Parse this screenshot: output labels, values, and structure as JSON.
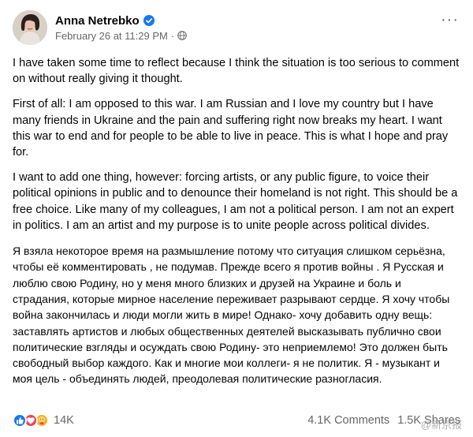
{
  "post": {
    "author": "Anna Netrebko",
    "timestamp": "February 26 at 11:29 PM",
    "separator": "·",
    "more_label": "···",
    "paragraphs": [
      "I have taken some time to reflect because I think the situation is too serious to comment on without really giving it thought.",
      "First of all: I am opposed to this war. I am Russian and I love my country but I have many friends in Ukraine and the pain and suffering right now breaks my heart. I want this war to end and for people to be able to live in peace. This is what I hope and pray for.",
      "I want to add one thing, however: forcing artists, or any public figure, to voice their political opinions in public and to denounce their homeland is not right. This should be a free choice. Like many of my colleagues, I am not a political person. I am not an expert in politics. I am an artist and my purpose is to unite people across political divides."
    ],
    "russian_paragraph": "Я взяла некоторое время на размышление потому что ситуация слишком серьёзна, чтобы её комментировать , не подумав. Прежде всего я против войны . Я Русская и люблю свою Родину, но у меня много близких и друзей на Украине и боль и страдания, которые мирное население переживает разрывают сердце. Я хочу чтобы война закончилась и люди могли жить в мире!   Однако- хочу добавить одну вещь: заставлять артистов и любых общественных деятелей высказывать публично свои политические взгляды и осуждать свою Родину- это неприемлемо! Это должен быть свободный выбор каждого. Как и многие мои коллеги- я не политик. Я  - музыкант и моя цель  - объединять людей, преодолевая политические разногласия.",
    "reaction_icons": [
      "like-icon",
      "love-icon",
      "care-icon"
    ],
    "reaction_count": "14K",
    "comments": "4.1K Comments",
    "shares": "1.5K Shares",
    "watermark": "@新京报"
  },
  "colors": {
    "verified": "#1877f2",
    "secondary_text": "#65676b",
    "like": "#1877f2",
    "love": "#f33e58",
    "care": "#f7b125"
  }
}
